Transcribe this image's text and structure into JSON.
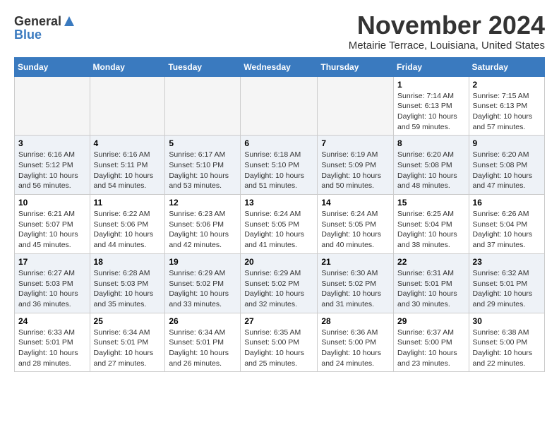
{
  "header": {
    "logo_general": "General",
    "logo_blue": "Blue",
    "month": "November 2024",
    "location": "Metairie Terrace, Louisiana, United States"
  },
  "weekdays": [
    "Sunday",
    "Monday",
    "Tuesday",
    "Wednesday",
    "Thursday",
    "Friday",
    "Saturday"
  ],
  "weeks": [
    [
      {
        "day": "",
        "info": ""
      },
      {
        "day": "",
        "info": ""
      },
      {
        "day": "",
        "info": ""
      },
      {
        "day": "",
        "info": ""
      },
      {
        "day": "",
        "info": ""
      },
      {
        "day": "1",
        "info": "Sunrise: 7:14 AM\nSunset: 6:13 PM\nDaylight: 10 hours\nand 59 minutes."
      },
      {
        "day": "2",
        "info": "Sunrise: 7:15 AM\nSunset: 6:13 PM\nDaylight: 10 hours\nand 57 minutes."
      }
    ],
    [
      {
        "day": "3",
        "info": "Sunrise: 6:16 AM\nSunset: 5:12 PM\nDaylight: 10 hours\nand 56 minutes."
      },
      {
        "day": "4",
        "info": "Sunrise: 6:16 AM\nSunset: 5:11 PM\nDaylight: 10 hours\nand 54 minutes."
      },
      {
        "day": "5",
        "info": "Sunrise: 6:17 AM\nSunset: 5:10 PM\nDaylight: 10 hours\nand 53 minutes."
      },
      {
        "day": "6",
        "info": "Sunrise: 6:18 AM\nSunset: 5:10 PM\nDaylight: 10 hours\nand 51 minutes."
      },
      {
        "day": "7",
        "info": "Sunrise: 6:19 AM\nSunset: 5:09 PM\nDaylight: 10 hours\nand 50 minutes."
      },
      {
        "day": "8",
        "info": "Sunrise: 6:20 AM\nSunset: 5:08 PM\nDaylight: 10 hours\nand 48 minutes."
      },
      {
        "day": "9",
        "info": "Sunrise: 6:20 AM\nSunset: 5:08 PM\nDaylight: 10 hours\nand 47 minutes."
      }
    ],
    [
      {
        "day": "10",
        "info": "Sunrise: 6:21 AM\nSunset: 5:07 PM\nDaylight: 10 hours\nand 45 minutes."
      },
      {
        "day": "11",
        "info": "Sunrise: 6:22 AM\nSunset: 5:06 PM\nDaylight: 10 hours\nand 44 minutes."
      },
      {
        "day": "12",
        "info": "Sunrise: 6:23 AM\nSunset: 5:06 PM\nDaylight: 10 hours\nand 42 minutes."
      },
      {
        "day": "13",
        "info": "Sunrise: 6:24 AM\nSunset: 5:05 PM\nDaylight: 10 hours\nand 41 minutes."
      },
      {
        "day": "14",
        "info": "Sunrise: 6:24 AM\nSunset: 5:05 PM\nDaylight: 10 hours\nand 40 minutes."
      },
      {
        "day": "15",
        "info": "Sunrise: 6:25 AM\nSunset: 5:04 PM\nDaylight: 10 hours\nand 38 minutes."
      },
      {
        "day": "16",
        "info": "Sunrise: 6:26 AM\nSunset: 5:04 PM\nDaylight: 10 hours\nand 37 minutes."
      }
    ],
    [
      {
        "day": "17",
        "info": "Sunrise: 6:27 AM\nSunset: 5:03 PM\nDaylight: 10 hours\nand 36 minutes."
      },
      {
        "day": "18",
        "info": "Sunrise: 6:28 AM\nSunset: 5:03 PM\nDaylight: 10 hours\nand 35 minutes."
      },
      {
        "day": "19",
        "info": "Sunrise: 6:29 AM\nSunset: 5:02 PM\nDaylight: 10 hours\nand 33 minutes."
      },
      {
        "day": "20",
        "info": "Sunrise: 6:29 AM\nSunset: 5:02 PM\nDaylight: 10 hours\nand 32 minutes."
      },
      {
        "day": "21",
        "info": "Sunrise: 6:30 AM\nSunset: 5:02 PM\nDaylight: 10 hours\nand 31 minutes."
      },
      {
        "day": "22",
        "info": "Sunrise: 6:31 AM\nSunset: 5:01 PM\nDaylight: 10 hours\nand 30 minutes."
      },
      {
        "day": "23",
        "info": "Sunrise: 6:32 AM\nSunset: 5:01 PM\nDaylight: 10 hours\nand 29 minutes."
      }
    ],
    [
      {
        "day": "24",
        "info": "Sunrise: 6:33 AM\nSunset: 5:01 PM\nDaylight: 10 hours\nand 28 minutes."
      },
      {
        "day": "25",
        "info": "Sunrise: 6:34 AM\nSunset: 5:01 PM\nDaylight: 10 hours\nand 27 minutes."
      },
      {
        "day": "26",
        "info": "Sunrise: 6:34 AM\nSunset: 5:01 PM\nDaylight: 10 hours\nand 26 minutes."
      },
      {
        "day": "27",
        "info": "Sunrise: 6:35 AM\nSunset: 5:00 PM\nDaylight: 10 hours\nand 25 minutes."
      },
      {
        "day": "28",
        "info": "Sunrise: 6:36 AM\nSunset: 5:00 PM\nDaylight: 10 hours\nand 24 minutes."
      },
      {
        "day": "29",
        "info": "Sunrise: 6:37 AM\nSunset: 5:00 PM\nDaylight: 10 hours\nand 23 minutes."
      },
      {
        "day": "30",
        "info": "Sunrise: 6:38 AM\nSunset: 5:00 PM\nDaylight: 10 hours\nand 22 minutes."
      }
    ]
  ]
}
